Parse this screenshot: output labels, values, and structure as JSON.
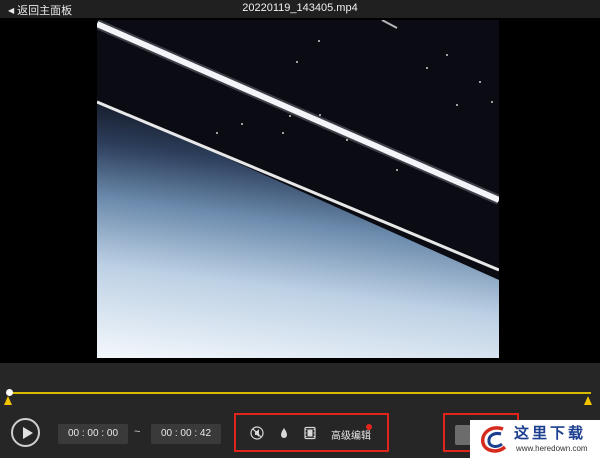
{
  "header": {
    "back_label": "返回主面板",
    "back_arrow": "◀",
    "file_name": "20220119_143405.mp4"
  },
  "trim": {
    "start_time": "00 : 00 : 00",
    "end_time": "00 : 00 : 42",
    "separator": "~",
    "accent_color": "#d9b800"
  },
  "toolbar": {
    "icons": [
      "mute-icon",
      "drop-icon",
      "film-icon"
    ],
    "advanced_edit_label": "高级编辑",
    "highlight_color": "#e0251b"
  },
  "watermark": {
    "name": "这里下载",
    "url": "www.heredown.com"
  }
}
